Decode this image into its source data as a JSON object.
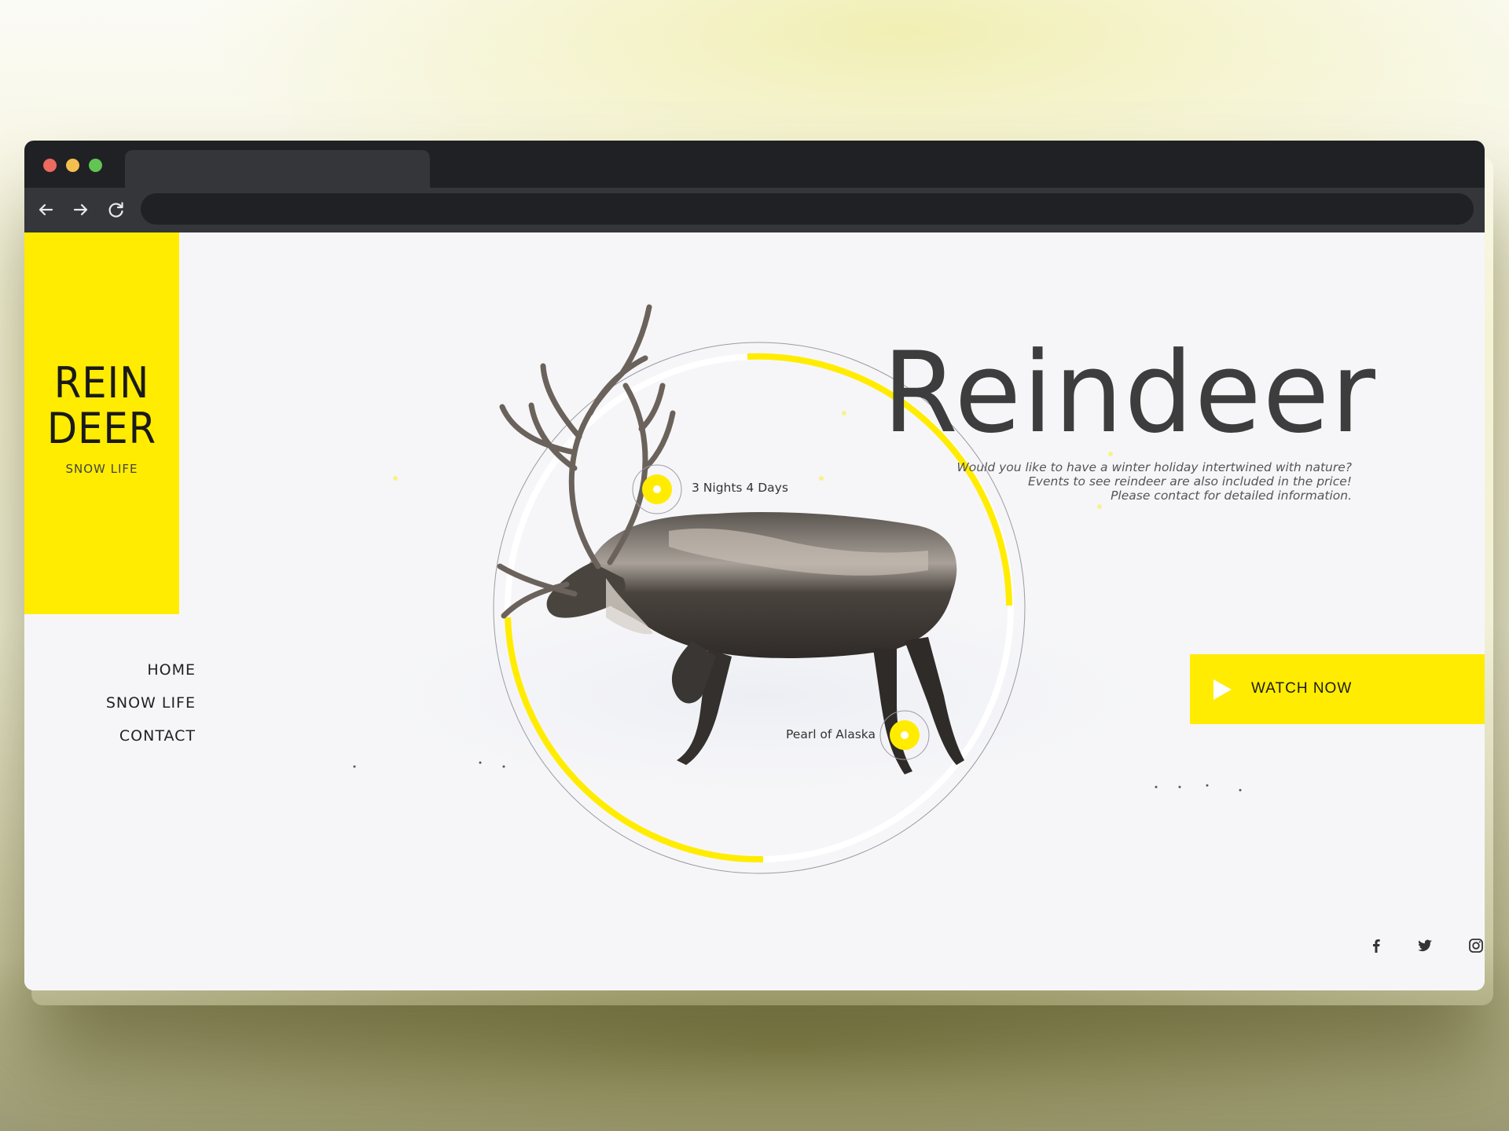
{
  "brand": {
    "line1": "REIN",
    "line2": "DEER",
    "subtitle": "SNOW LIFE",
    "accent_color": "#ffec00"
  },
  "nav": {
    "items": [
      {
        "label": "HOME"
      },
      {
        "label": "SNOW LIFE"
      },
      {
        "label": "CONTACT"
      }
    ]
  },
  "hero": {
    "title": "Reindeer",
    "description": [
      "Would you like to have a winter holiday intertwined with nature?",
      "Events to see reindeer are also included in the price!",
      "Please contact for detailed information."
    ]
  },
  "callouts": [
    {
      "label": "3 Nights 4 Days"
    },
    {
      "label": "Pearl of Alaska"
    }
  ],
  "cta": {
    "label": "WATCH NOW",
    "icon": "play-icon"
  },
  "social": [
    {
      "icon": "facebook-icon"
    },
    {
      "icon": "twitter-icon"
    },
    {
      "icon": "instagram-icon"
    }
  ],
  "browser": {
    "nav_icons": [
      "back-arrow-icon",
      "forward-arrow-icon",
      "reload-icon"
    ],
    "window_controls": [
      "close-dot",
      "minimize-dot",
      "maximize-dot"
    ]
  }
}
